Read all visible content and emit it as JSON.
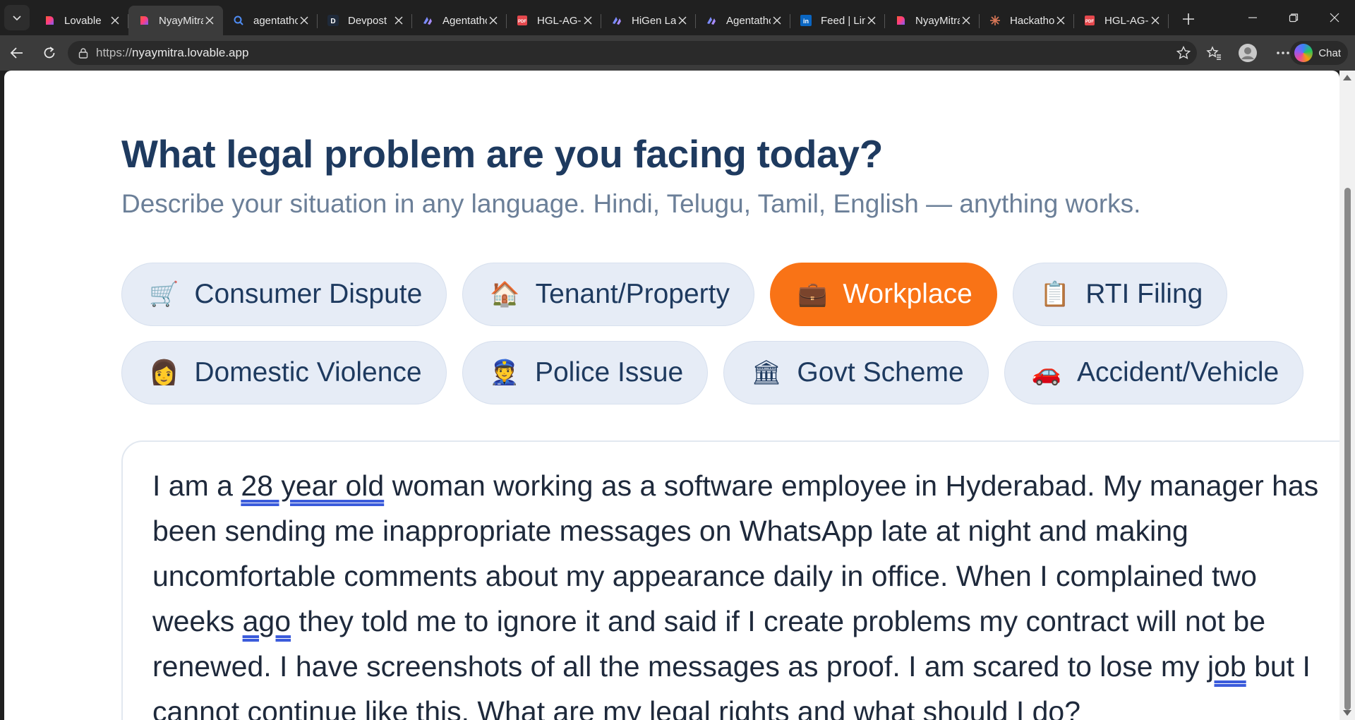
{
  "browser": {
    "tabs": [
      {
        "title": "Lovable",
        "favicon": "lovable-icon",
        "active": false
      },
      {
        "title": "NyayMitra",
        "favicon": "lovable-icon",
        "active": true
      },
      {
        "title": "agentathon",
        "favicon": "search-icon",
        "active": false
      },
      {
        "title": "Devpost",
        "favicon": "devpost-icon",
        "active": false
      },
      {
        "title": "Agentathon",
        "favicon": "agentathon-icon",
        "active": false
      },
      {
        "title": "HGL-AG-",
        "favicon": "pdf-icon",
        "active": false
      },
      {
        "title": "HiGen Lab",
        "favicon": "agentathon-icon",
        "active": false
      },
      {
        "title": "Agentathon",
        "favicon": "agentathon-icon",
        "active": false
      },
      {
        "title": "Feed | LinkedIn",
        "favicon": "linkedin-icon",
        "active": false
      },
      {
        "title": "NyayMitra",
        "favicon": "lovable-icon",
        "active": false
      },
      {
        "title": "Hackathon",
        "favicon": "claude-icon",
        "active": false
      },
      {
        "title": "HGL-AG-",
        "favicon": "pdf-icon",
        "active": false
      }
    ],
    "url_protocol": "https://",
    "url_host": "nyaymitra.lovable.app",
    "chat_label": "Chat"
  },
  "page": {
    "title": "What legal problem are you facing today?",
    "subtitle": "Describe your situation in any language. Hindi, Telugu, Tamil, English — anything works.",
    "categories_row1": [
      {
        "label": "Consumer Dispute",
        "icon": "🛒",
        "icon_name": "shopping-cart-icon",
        "active": false
      },
      {
        "label": "Tenant/Property",
        "icon": "🏠",
        "icon_name": "house-icon",
        "active": false
      },
      {
        "label": "Workplace",
        "icon": "💼",
        "icon_name": "briefcase-icon",
        "active": true
      },
      {
        "label": "RTI Filing",
        "icon": "📋",
        "icon_name": "clipboard-icon",
        "active": false
      }
    ],
    "categories_row2": [
      {
        "label": "Domestic Violence",
        "icon": "👩",
        "icon_name": "woman-icon",
        "active": false
      },
      {
        "label": "Police Issue",
        "icon": "👮",
        "icon_name": "police-officer-icon",
        "active": false
      },
      {
        "label": "Govt Scheme",
        "icon": "🏛",
        "icon_name": "government-building-icon",
        "active": false
      },
      {
        "label": "Accident/Vehicle",
        "icon": "🚗",
        "icon_name": "car-icon",
        "active": false
      }
    ],
    "description": {
      "p1": "I am a ",
      "s1": "28 year old",
      "p2": " woman working as a software employee in Hyderabad. My manager has been sending me inappropriate messages on WhatsApp late at night and making uncomfortable comments about my appearance daily in office. When I complained two weeks ",
      "s2": "ago",
      "p3": " they told me to ignore it and said if I create problems my contract will not be renewed. I have screenshots of all the messages as proof. I am scared to lose my ",
      "s3": "job",
      "p4": " but I cannot continue like this. What are my legal rights and what should I do?"
    }
  },
  "colors": {
    "accent": "#f97316",
    "title": "#1e3a5f",
    "subtitle": "#6b7f98",
    "chip_bg": "#e6ecf6"
  }
}
